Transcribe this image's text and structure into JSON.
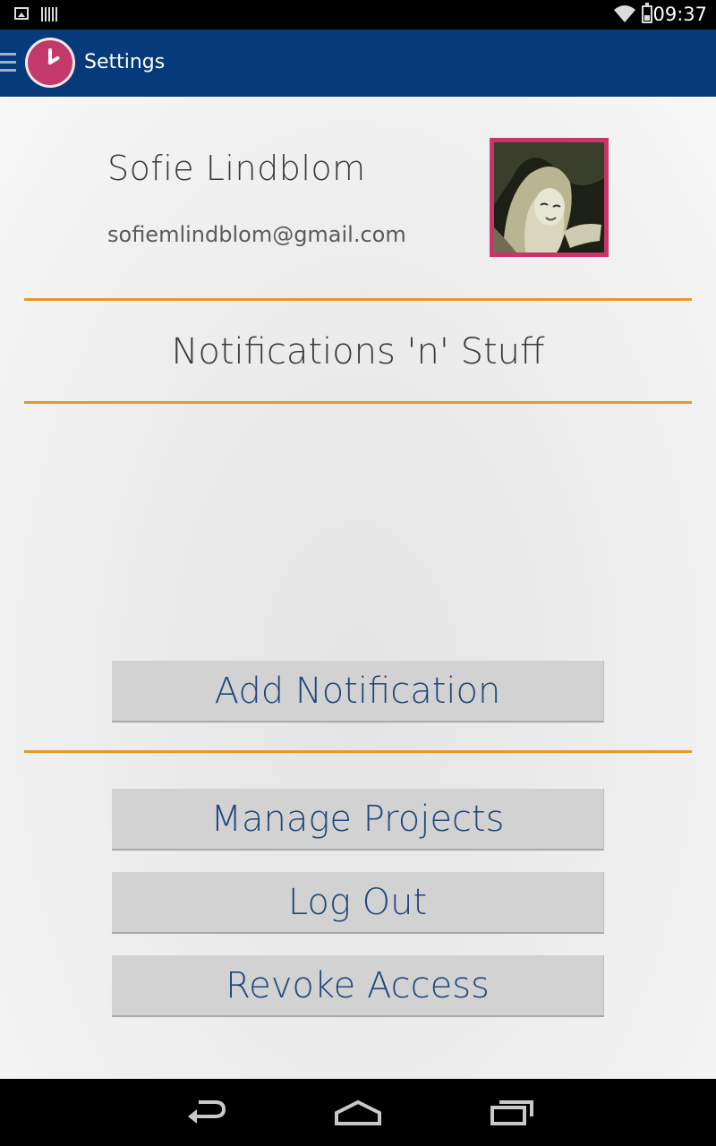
{
  "status_bar": {
    "time": "09:37",
    "icons": [
      "image-notification-icon",
      "barcode-notification-icon",
      "wifi-icon",
      "battery-icon"
    ]
  },
  "action_bar": {
    "title": "Settings",
    "icons": [
      "drawer-menu-icon",
      "clock-app-icon"
    ]
  },
  "profile": {
    "name": "Sofie Lindblom",
    "email": "sofiemlindblom@gmail.com",
    "avatar_icon": "user-photo"
  },
  "notifications": {
    "title": "Notifications 'n' Stuff",
    "add_label": "Add Notification"
  },
  "actions": {
    "manage_projects": "Manage Projects",
    "log_out": "Log Out",
    "revoke_access": "Revoke Access"
  },
  "nav_bar": {
    "icons": [
      "back-icon",
      "home-icon",
      "recent-apps-icon"
    ]
  },
  "colors": {
    "action_bar": "#073a7a",
    "divider": "#e49a2a",
    "button_text": "#1f477a",
    "avatar_border": "#c8356a",
    "logo": "#c33a6a"
  }
}
